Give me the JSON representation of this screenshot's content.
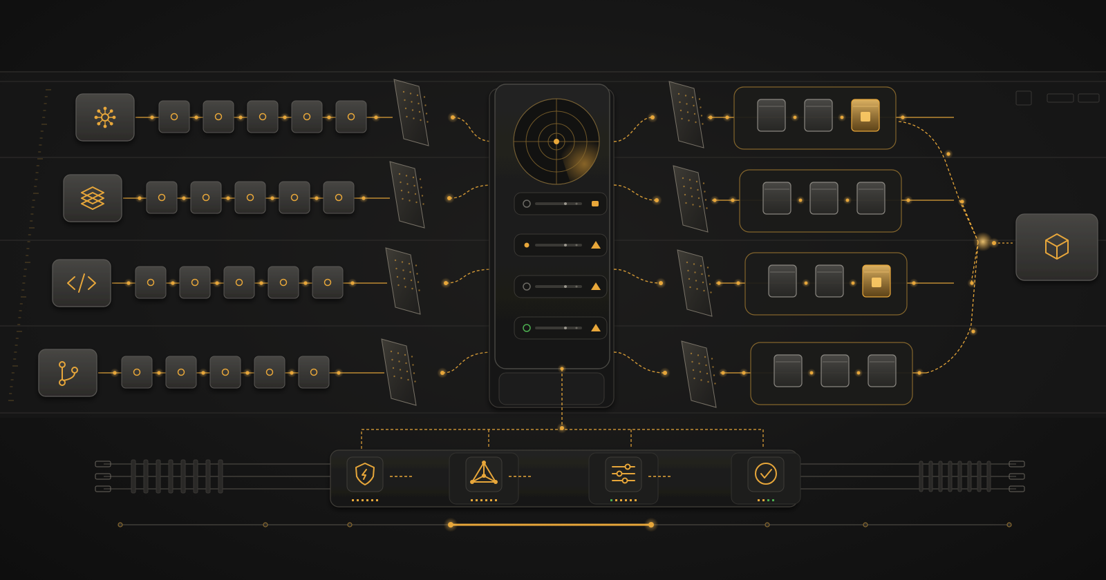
{
  "palette": {
    "accent": "#e8a73a",
    "accent_dim": "#8a6a2e",
    "panel": "#1b1b1a",
    "node": "#3a3937",
    "node_border": "#5a5854",
    "status_ok": "#4caf50"
  },
  "sources": [
    {
      "icon": "network-hub-icon",
      "steps": 5
    },
    {
      "icon": "layers-icon",
      "steps": 5
    },
    {
      "icon": "code-icon",
      "steps": 5
    },
    {
      "icon": "git-branch-icon",
      "steps": 5
    }
  ],
  "hub": {
    "radar": "radar-icon",
    "status_rows": [
      {
        "indicator": "ring",
        "badge": "square"
      },
      {
        "indicator": "dot",
        "badge": "warning"
      },
      {
        "indicator": "ring",
        "badge": "warning"
      },
      {
        "indicator": "ring-green",
        "badge": "warning"
      }
    ]
  },
  "outputs": [
    {
      "cubes": 3,
      "highlighted": [
        2
      ]
    },
    {
      "cubes": 3,
      "highlighted": []
    },
    {
      "cubes": 3,
      "highlighted": [
        2
      ]
    },
    {
      "cubes": 3,
      "highlighted": []
    }
  ],
  "target": {
    "icon": "cube-icon"
  },
  "controls": [
    {
      "icon": "shield-icon",
      "dots": 6,
      "green": 0
    },
    {
      "icon": "network-triangle-icon",
      "dots": 6,
      "green": 0
    },
    {
      "icon": "sliders-icon",
      "dots": 6,
      "green": 1
    },
    {
      "icon": "check-circle-icon",
      "dots": 4,
      "green": 2
    }
  ],
  "timeline": {
    "markers": 8,
    "active_range": [
      2,
      4
    ]
  }
}
